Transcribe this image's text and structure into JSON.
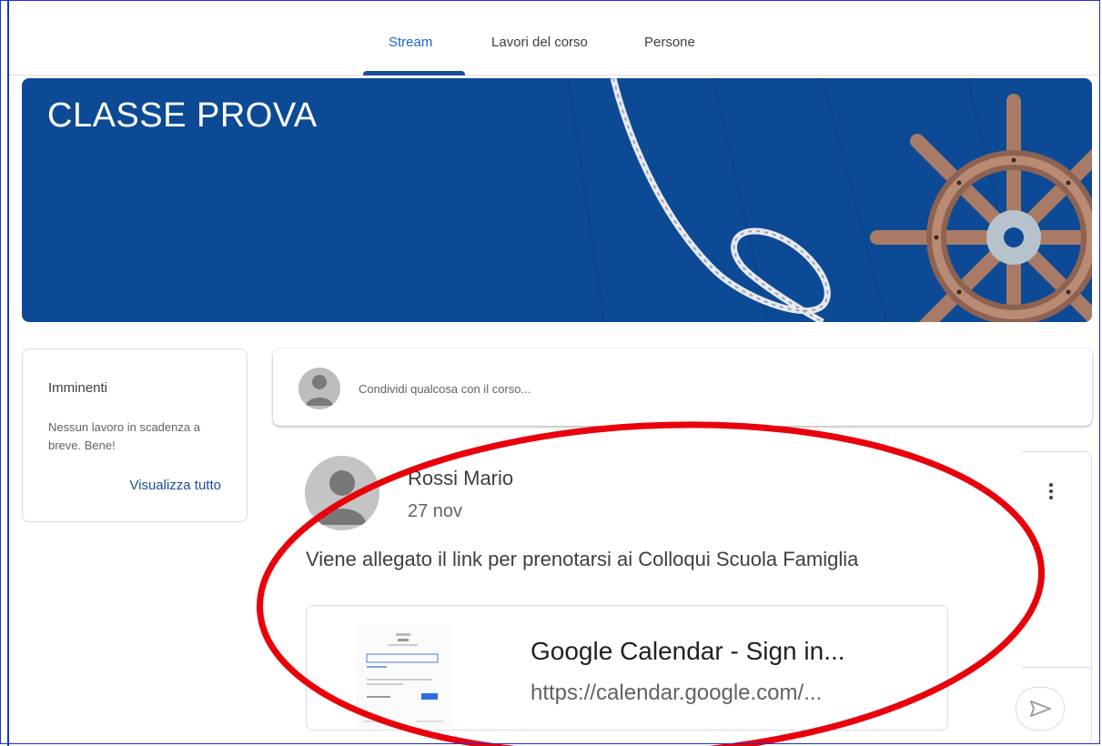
{
  "tabs": [
    {
      "label": "Stream",
      "active": true
    },
    {
      "label": "Lavori del corso",
      "active": false
    },
    {
      "label": "Persone",
      "active": false
    }
  ],
  "banner": {
    "title": "CLASSE PROVA",
    "color": "#0d4a95"
  },
  "upcoming": {
    "title": "Imminenti",
    "message": "Nessun lavoro in scadenza a breve. Bene!",
    "link": "Visualizza tutto"
  },
  "share": {
    "placeholder": "Condividi qualcosa con il corso..."
  },
  "post": {
    "author": "Rossi Mario",
    "date": "27 nov",
    "text": "Viene allegato il link per prenotarsi ai Colloqui Scuola Famiglia",
    "attachment": {
      "title": "Google Calendar - Sign in...",
      "url": "https://calendar.google.com/..."
    }
  },
  "colors": {
    "accent": "#1a4e9b",
    "highlight_ellipse": "#e8000b",
    "frame": "#1a32d6"
  }
}
